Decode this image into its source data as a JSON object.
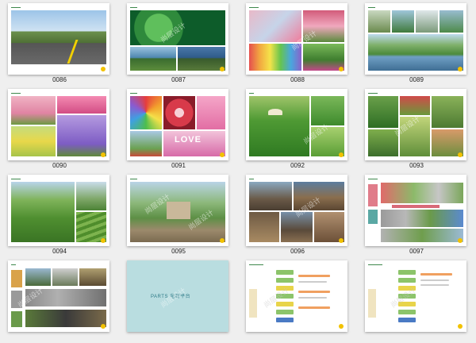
{
  "captions": [
    "0086",
    "0087",
    "0088",
    "0089",
    "0090",
    "0091",
    "0092",
    "0093",
    "0094",
    "0095",
    "0096",
    "0097"
  ],
  "watermark": "尚层设计",
  "slide_0091": {
    "love": "LOVE"
  },
  "slide_parts": {
    "title": "PARTS 电商平台"
  },
  "colors": {
    "accent_yellow": "#f2c200",
    "parts_bg": "#b9dde0"
  }
}
